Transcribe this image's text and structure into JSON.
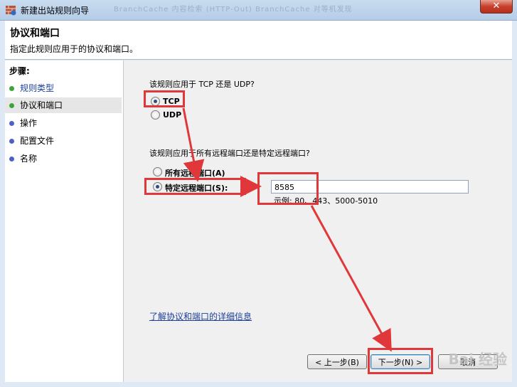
{
  "window": {
    "title": "新建出站规则向导",
    "close_symbol": "✕",
    "background_tabs": "BranchCache 内容检索 (HTTP-Out)   BranchCache 对等机发现"
  },
  "header": {
    "title": "协议和端口",
    "subtitle": "指定此规则应用于的协议和端口。"
  },
  "sidebar": {
    "title": "步骤:",
    "items": [
      {
        "label": "规则类型",
        "dot_color": "#3aa63a"
      },
      {
        "label": "协议和端口",
        "dot_color": "#3aa63a"
      },
      {
        "label": "操作",
        "dot_color": "#4f5fc9"
      },
      {
        "label": "配置文件",
        "dot_color": "#4f5fc9"
      },
      {
        "label": "名称",
        "dot_color": "#4f5fc9"
      }
    ]
  },
  "protocol": {
    "question": "该规则应用于 TCP 还是 UDP?",
    "options": [
      {
        "label": "TCP",
        "selected": true
      },
      {
        "label": "UDP",
        "selected": false
      }
    ]
  },
  "ports": {
    "question": "该规则应用于所有远程端口还是特定远程端口?",
    "options": [
      {
        "label": "所有远程端口(A)",
        "selected": false
      },
      {
        "label": "特定远程端口(S):",
        "selected": true
      }
    ],
    "value": "8585",
    "example": "示例: 80、443、5000-5010"
  },
  "link": "了解协议和端口的详细信息",
  "buttons": {
    "back": "< 上一步(B)",
    "next": "下一步(N) >",
    "cancel": "取消"
  },
  "annotation_color": "#e0383a",
  "watermark": "Bai 经验"
}
